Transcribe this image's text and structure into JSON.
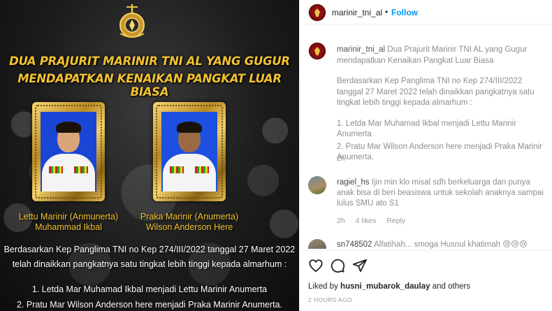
{
  "post_image": {
    "headline_line1": "DUA PRAJURIT MARINIR TNI AL YANG GUGUR",
    "headline_line2": "MENDAPATKAN KENAIKAN PANGKAT LUAR BIASA",
    "soldier1": {
      "rank": "Lettu Marinir (Anmunerta)",
      "name": "Muhammad Ikbal"
    },
    "soldier2": {
      "rank": "Praka Marinir (Anumerta)",
      "name": "Wilson Anderson Here"
    },
    "body_line1": "Berdasarkan Kep Panglima TNI no Kep 274/III/2022 tanggal 27 Maret 2022",
    "body_line2": "telah dinaikkan pangkatnya satu tingkat lebih tinggi kepada almarhum :",
    "body_line3": "1. Letda Mar Muhamad Ikbal menjadi Lettu Marinir Anumerta",
    "body_line4": "2. Pratu Mar Wilson Anderson here menjadi Praka Marinir Anumerta.",
    "colors": {
      "headline": "#f2c230",
      "frame_gold": "#d9a93a",
      "photo_bg": "#1a46d6"
    }
  },
  "header": {
    "username": "marinir_tni_al",
    "separator": "•",
    "follow_label": "Follow",
    "follow_color": "#0095f6"
  },
  "caption": {
    "username": "marinir_tni_al",
    "title": "Dua Prajurit Marinir TNI AL yang Gugur mendapatkan Kenaikan Pangkat Luar Biasa",
    "paragraph": "Berdasarkan Kep Panglima TNI no Kep 274/III/2022 tanggal 27 Maret 2022 telah dinaikkan pangkatnya satu tingkat lebih tinggi kepada almarhum :",
    "item1": "1. Letda Mar Muhamad Ikbal menjadi Lettu Marinir Anumerta",
    "item2": "2. Pratu Mar Wilson Anderson here menjadi Praka Marinir Anumerta.",
    "time": "2h"
  },
  "comments": [
    {
      "username": "ragiel_hs",
      "text": "Ijin min klo misal sdh berkeluarga dan punya anak bisa di beri beasiswa untuk sekolah anaknya sampai lulus SMU ato S1",
      "time": "2h",
      "likes": "4 likes",
      "reply_label": "Reply"
    },
    {
      "username": "sn748502",
      "text": "Alfatihah... smoga Husnul khatimah 😢😢😢"
    }
  ],
  "actions": {
    "liked_by_prefix": "Liked by",
    "liked_by_user": "husni_mubarok_daulay",
    "liked_by_suffix": "and others",
    "time_ago": "2 HOURS AGO",
    "icons": [
      "heart-icon",
      "comment-icon",
      "share-icon"
    ]
  }
}
